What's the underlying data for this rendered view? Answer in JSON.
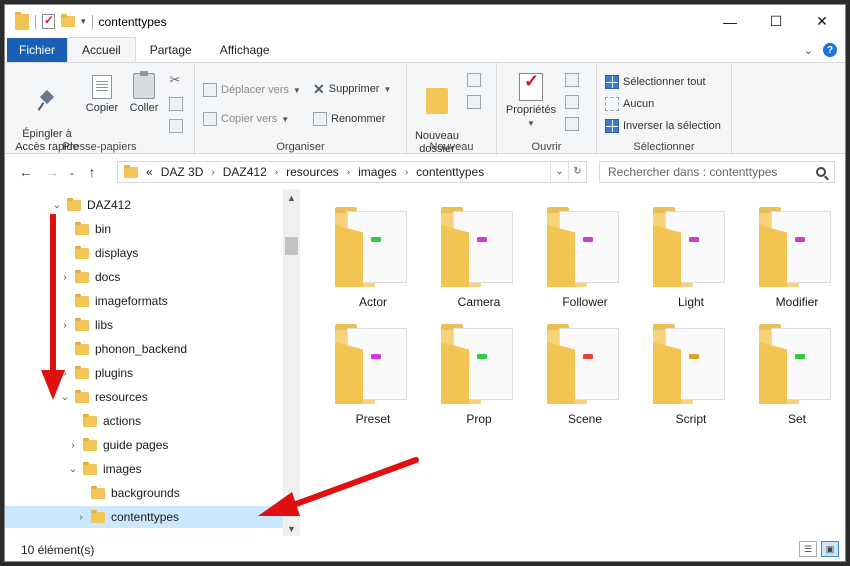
{
  "window": {
    "title": "contenttypes",
    "controls": {
      "minimize": "—",
      "maximize": "☐",
      "close": "✕"
    }
  },
  "ribbon_tabs": [
    {
      "label": "Fichier"
    },
    {
      "label": "Accueil"
    },
    {
      "label": "Partage"
    },
    {
      "label": "Affichage"
    }
  ],
  "ribbon": {
    "presse_papiers": {
      "label": "Presse-papiers",
      "pin": "Épingler à\nAccès rapide",
      "copy": "Copier",
      "paste": "Coller"
    },
    "organiser": {
      "label": "Organiser",
      "move_to": "Déplacer vers",
      "copy_to": "Copier vers",
      "delete": "Supprimer",
      "rename": "Renommer"
    },
    "nouveau": {
      "label": "Nouveau",
      "new_folder": "Nouveau\ndossier"
    },
    "ouvrir": {
      "label": "Ouvrir",
      "properties": "Propriétés"
    },
    "selectionner": {
      "label": "Sélectionner",
      "select_all": "Sélectionner tout",
      "select_none": "Aucun",
      "invert": "Inverser la sélection"
    }
  },
  "address": {
    "prefix": "«",
    "crumbs": [
      "DAZ 3D",
      "DAZ412",
      "resources",
      "images",
      "contenttypes"
    ]
  },
  "search": {
    "placeholder": "Rechercher dans : contenttypes"
  },
  "tree": [
    {
      "label": "DAZ412",
      "chevron": "⌄"
    },
    {
      "label": "bin",
      "chevron": ""
    },
    {
      "label": "displays",
      "chevron": ""
    },
    {
      "label": "docs",
      "chevron": "›"
    },
    {
      "label": "imageformats",
      "chevron": ""
    },
    {
      "label": "libs",
      "chevron": "›"
    },
    {
      "label": "phonon_backend",
      "chevron": ""
    },
    {
      "label": "plugins",
      "chevron": "›"
    },
    {
      "label": "resources",
      "chevron": "⌄"
    },
    {
      "label": "actions",
      "chevron": ""
    },
    {
      "label": "guide pages",
      "chevron": "›"
    },
    {
      "label": "images",
      "chevron": "⌄"
    },
    {
      "label": "backgrounds",
      "chevron": ""
    },
    {
      "label": "contenttypes",
      "chevron": "›"
    }
  ],
  "folders": [
    {
      "label": "Actor",
      "chip": "#2ecc40"
    },
    {
      "label": "Camera",
      "chip": "#d63ad6"
    },
    {
      "label": "Follower",
      "chip": "#d63ad6"
    },
    {
      "label": "Light",
      "chip": "#d63ad6"
    },
    {
      "label": "Modifier",
      "chip": "#d63ad6"
    },
    {
      "label": "Preset",
      "chip": "#d63ad6"
    },
    {
      "label": "Prop",
      "chip": "#2ecc40"
    },
    {
      "label": "Scene",
      "chip": "#e8453c"
    },
    {
      "label": "Script",
      "chip": "#e0a020"
    },
    {
      "label": "Set",
      "chip": "#2ecc40"
    }
  ],
  "status": {
    "count": "10 élément(s)"
  },
  "colors": {
    "accent": "#1a5fb4",
    "selection": "#cce8ff",
    "annotation_arrow": "#e01010"
  }
}
